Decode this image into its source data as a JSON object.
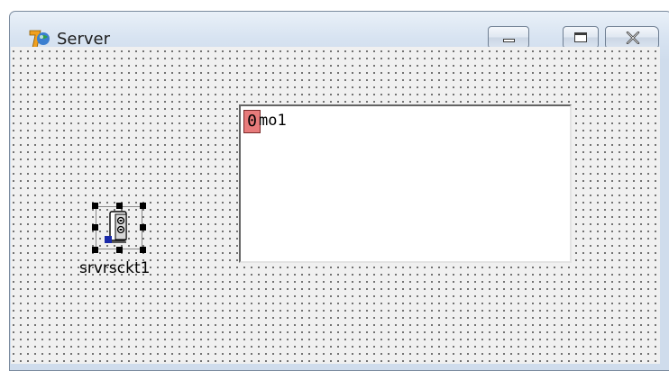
{
  "window": {
    "title": "Server",
    "icon": "delphi-7-icon"
  },
  "title_buttons": [
    "minimize-icon",
    "maximize-icon",
    "close-icon"
  ],
  "memo": {
    "marker": "0",
    "text": "mo1"
  },
  "component": {
    "name": "srvrsckt1",
    "icon": "server-socket-icon"
  },
  "colors": {
    "title_gradient": "#d7e3f1",
    "form_background": "#f0f0f0",
    "memo_marker": "#e77b7b",
    "selection_handle_anchor": "#1a2aa8"
  }
}
